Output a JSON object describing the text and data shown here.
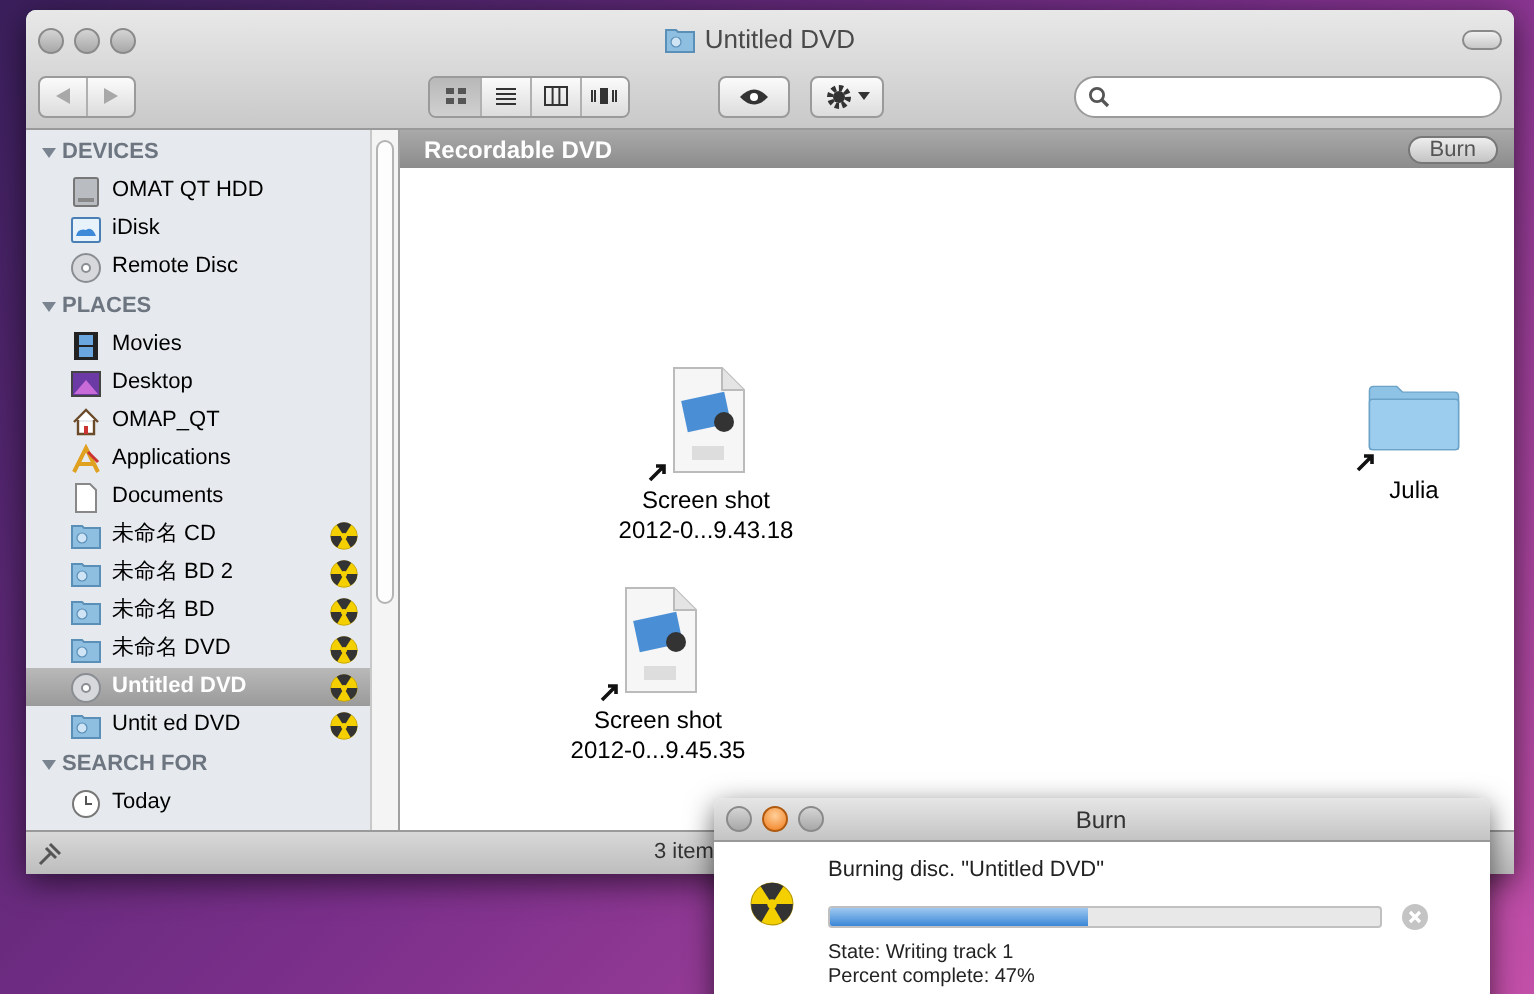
{
  "window": {
    "title": "Untitled DVD"
  },
  "toolbar": {
    "nav": [
      {
        "kind": "back",
        "disabled": true
      },
      {
        "kind": "forward",
        "disabled": true
      }
    ],
    "views": [
      {
        "kind": "icons",
        "selected": true
      },
      {
        "kind": "list",
        "selected": false
      },
      {
        "kind": "columns",
        "selected": false
      },
      {
        "kind": "coverflow",
        "selected": false
      }
    ]
  },
  "sidebar": {
    "sections": [
      {
        "title": "DEVICES",
        "expanded": true,
        "items": [
          {
            "label": "OMAT QT HDD",
            "kind": "hdd",
            "selected": false,
            "burn_pending": false
          },
          {
            "label": "iDisk",
            "kind": "idisk",
            "selected": false,
            "burn_pending": false
          },
          {
            "label": "Remote Disc",
            "kind": "disc",
            "selected": false,
            "burn_pending": false
          }
        ]
      },
      {
        "title": "PLACES",
        "expanded": true,
        "items": [
          {
            "label": "Movies",
            "kind": "movies",
            "selected": false,
            "burn_pending": false
          },
          {
            "label": "Desktop",
            "kind": "desktop",
            "selected": false,
            "burn_pending": false
          },
          {
            "label": "OMAP_QT",
            "kind": "home",
            "selected": false,
            "burn_pending": false
          },
          {
            "label": "Applications",
            "kind": "apps",
            "selected": false,
            "burn_pending": false
          },
          {
            "label": "Documents",
            "kind": "docs",
            "selected": false,
            "burn_pending": false
          },
          {
            "label": "未命名 CD",
            "kind": "burnfolder",
            "selected": false,
            "burn_pending": true
          },
          {
            "label": "未命名 BD 2",
            "kind": "burnfolder",
            "selected": false,
            "burn_pending": true
          },
          {
            "label": "未命名 BD",
            "kind": "burnfolder",
            "selected": false,
            "burn_pending": true
          },
          {
            "label": "未命名 DVD",
            "kind": "burnfolder",
            "selected": false,
            "burn_pending": true
          },
          {
            "label": "Untitled DVD",
            "kind": "disc",
            "selected": true,
            "burn_pending": true
          },
          {
            "label": "Untit ed DVD",
            "kind": "burnfolder",
            "selected": false,
            "burn_pending": true
          }
        ]
      },
      {
        "title": "SEARCH FOR",
        "expanded": true,
        "items": [
          {
            "label": "Today",
            "kind": "clock",
            "selected": false,
            "burn_pending": false
          }
        ]
      }
    ]
  },
  "content": {
    "header": "Recordable DVD",
    "burn_button": "Burn",
    "files": [
      {
        "kind": "png",
        "line_1": "Screen shot",
        "line_2": "2012-0...9.43.18",
        "alias": true
      },
      {
        "kind": "png",
        "line_1": "Screen shot",
        "line_2": "2012-0...9.45.35",
        "alias": true
      },
      {
        "kind": "folder",
        "line_1": "Julia",
        "alias": true
      }
    ]
  },
  "status_bar": {
    "text": "3 item"
  },
  "burn_dialog": {
    "title": "Burn",
    "message": "Burning disc. \"Untitled DVD\"",
    "level": 0.47,
    "state": "State: Writing track 1",
    "percent": "Percent complete: 47%"
  }
}
